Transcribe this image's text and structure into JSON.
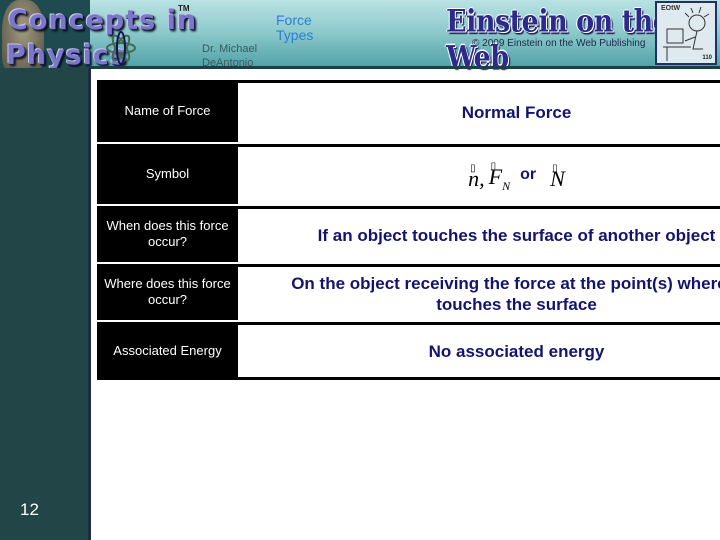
{
  "header": {
    "logo_line1": "Concepts in",
    "logo_line2": "Physics",
    "trademark": "TM",
    "author_line1": "Dr. Michael",
    "author_line2": "DeAntonio",
    "title_line1": "Force",
    "title_line2": "Types",
    "brand": "Einstein on the Web",
    "copyright": "© 2009 Einstein on the Web Publishing",
    "cartoon_label": "EOtW",
    "cartoon_number": "110"
  },
  "sidebar": {
    "slide_number": "12"
  },
  "table": {
    "rows": [
      {
        "label": "Name of Force",
        "value": "Normal Force"
      },
      {
        "label": "Symbol",
        "value": "n, F_N or N",
        "symbols": {
          "s1": "n",
          "sep": ",",
          "s2": "F",
          "s2_sub": "N",
          "or": "or",
          "s3": "N",
          "vector_mark": "▯"
        }
      },
      {
        "label": "When does this force occur?",
        "value": "If an object touches the surface of another object"
      },
      {
        "label": "Where does this force occur?",
        "value": "On the object receiving the force at the point(s) where it touches the surface"
      },
      {
        "label": "Associated Energy",
        "value": "No associated energy"
      }
    ]
  },
  "colors": {
    "label_bg": "#000000",
    "value_text": "#14146e",
    "sidebar": "#224548",
    "title_text": "#2a7fd6"
  }
}
